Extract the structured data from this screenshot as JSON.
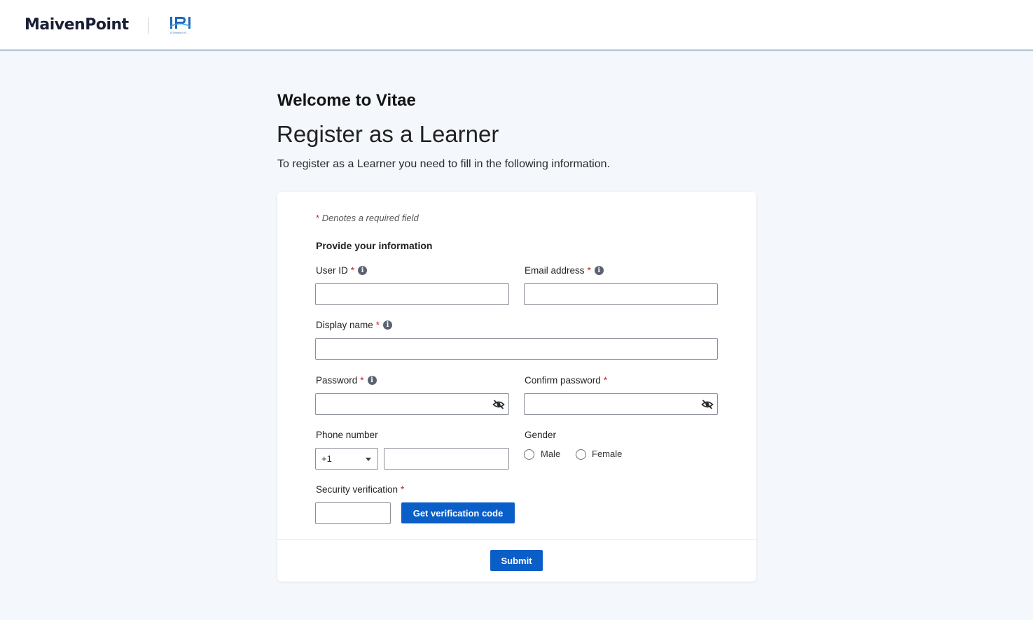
{
  "header": {
    "brand": "MaivenPoint",
    "partner_logo": "IPI",
    "partner_caption": "A Division of ..."
  },
  "page": {
    "welcome": "Welcome to Vitae",
    "title": "Register as a Learner",
    "subtitle": "To register as a Learner you need to fill in the following information."
  },
  "form": {
    "required_star": "*",
    "required_note": "Denotes a required field",
    "section_title": "Provide your information",
    "user_id_label": "User ID",
    "email_label": "Email address",
    "display_name_label": "Display name",
    "password_label": "Password",
    "confirm_password_label": "Confirm password",
    "phone_label": "Phone number",
    "country_code": "+1",
    "gender_label": "Gender",
    "gender_options": [
      "Male",
      "Female"
    ],
    "security_label": "Security verification",
    "get_code_button": "Get verification code",
    "submit_button": "Submit",
    "info_glyph": "i"
  },
  "colors": {
    "accent": "#0a5ec8",
    "required": "#c62828",
    "background": "#f4f7fc",
    "header_border": "#2f5f86"
  },
  "icons": {
    "info": "info-circle-icon",
    "eye": "eye-slash-icon",
    "caret": "chevron-down-icon"
  }
}
